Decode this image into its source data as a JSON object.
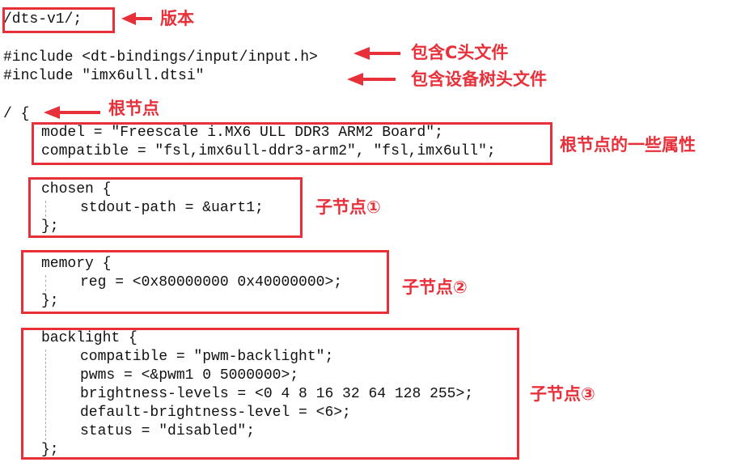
{
  "code": {
    "version": "/dts-v1/;",
    "include_c": "#include <dt-bindings/input/input.h>",
    "include_dtsi": "#include \"imx6ull.dtsi\"",
    "root_open": "/ {",
    "model": "model = \"Freescale i.MX6 ULL DDR3 ARM2 Board\";",
    "compatible": "compatible = \"fsl,imx6ull-ddr3-arm2\", \"fsl,imx6ull\";",
    "chosen_open": "chosen {",
    "chosen_stdout": "stdout-path = &uart1;",
    "chosen_close": "};",
    "memory_open": "memory {",
    "memory_reg": "reg = <0x80000000 0x40000000>;",
    "memory_close": "};",
    "backlight_open": "backlight {",
    "backlight_compatible": "compatible = \"pwm-backlight\";",
    "backlight_pwms": "pwms = <&pwm1 0 5000000>;",
    "backlight_levels": "brightness-levels = <0 4 8 16 32 64 128 255>;",
    "backlight_default": "default-brightness-level = <6>;",
    "backlight_status": "status = \"disabled\";",
    "backlight_close": "};"
  },
  "annotations": {
    "version": "版本",
    "include_c": "包含C头文件",
    "include_dtsi": "包含设备树头文件",
    "root_node": "根节点",
    "root_props": "根节点的一些属性",
    "child1": "子节点①",
    "child2": "子节点②",
    "child3": "子节点③"
  },
  "colors": {
    "annotation": "#e8303a",
    "code_text": "#111111",
    "guide": "#a9a9a9"
  }
}
